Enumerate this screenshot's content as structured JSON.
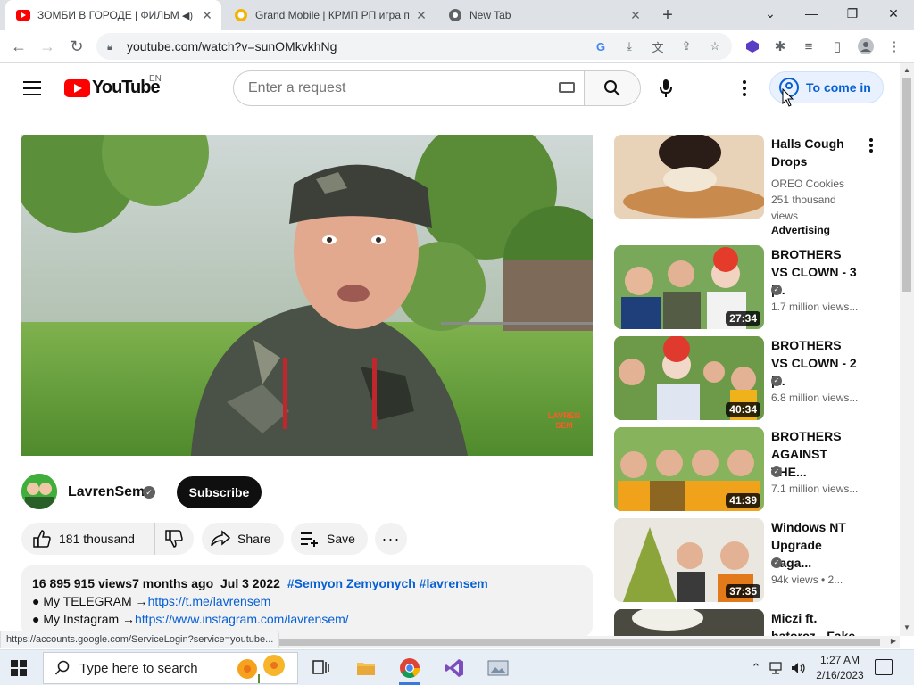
{
  "browser": {
    "tabs": [
      {
        "title": "ЗОМБИ В ГОРОДЕ | ФИЛЬМ",
        "active": true
      },
      {
        "title": "Grand Mobile | КРМП РП игра п",
        "active": false
      },
      {
        "title": "New Tab",
        "active": false
      }
    ],
    "url": "youtube.com/watch?v=sunOMkvkhNg",
    "status_url": "https://accounts.google.com/ServiceLogin?service=youtube..."
  },
  "masthead": {
    "logo_text": "YouTube",
    "country": "EN",
    "search_placeholder": "Enter a request",
    "signin_label": "To come in"
  },
  "video": {
    "watermark": "LAVREN SEM",
    "channel": "LavrenSem",
    "subscribe_label": "Subscribe",
    "likes": "181 thousand",
    "share_label": "Share",
    "save_label": "Save",
    "more_label": "···",
    "description": {
      "views": "16 895 915 views",
      "age": "7 months ago",
      "date": "Jul 3 2022",
      "tags": "#Semyon Zemyonych #lavrensem",
      "telegram_label": "● My TELEGRAM →",
      "telegram_url": "https://t.me/lavrensem",
      "instagram_label": "● My Instagram →",
      "instagram_url": "https://www.instagram.com/lavrensem/"
    }
  },
  "sidebar": {
    "ad": {
      "title": "Halls Cough Drops",
      "channel": "OREO Cookies",
      "views": "251 thousand views",
      "label": "Advertising"
    },
    "items": [
      {
        "title": "BROTHERS VS CLOWN - 3 |...",
        "meta": "1.7 million views...",
        "duration": "27:34"
      },
      {
        "title": "BROTHERS VS CLOWN - 2 |...",
        "meta": "6.8 million views...",
        "duration": "40:34"
      },
      {
        "title": "BROTHERS AGAINST THE...",
        "meta": "7.1 million views...",
        "duration": "41:39"
      },
      {
        "title": "Windows NT Upgrade Saga...",
        "meta": "94k views  • 2...",
        "duration": "37:35"
      },
      {
        "title": "Miczi ft. hatorcz - Fake",
        "meta": "",
        "duration": ""
      }
    ]
  },
  "taskbar": {
    "search_placeholder": "Type here to search",
    "time": "1:27 AM",
    "date": "2/16/2023"
  },
  "colors": {
    "youtube_red": "#ff0000",
    "link_blue": "#065fd4",
    "signin_bg": "#e8f1fd"
  }
}
